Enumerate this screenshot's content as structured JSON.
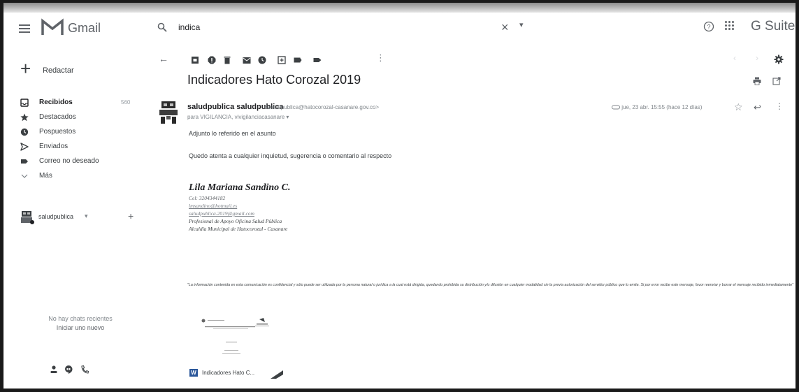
{
  "app": {
    "title": "Gmail",
    "suite_label": "G Suite"
  },
  "search": {
    "value": "indica"
  },
  "sidebar": {
    "compose_label": "Redactar",
    "items": [
      {
        "label": "Recibidos",
        "count": "560",
        "icon": "inbox-icon"
      },
      {
        "label": "Destacados",
        "icon": "star-icon"
      },
      {
        "label": "Pospuestos",
        "icon": "clock-icon"
      },
      {
        "label": "Enviados",
        "icon": "send-icon"
      },
      {
        "label": "Correo no deseado",
        "icon": "spam-icon"
      },
      {
        "label": "Más",
        "icon": "chevron-down-icon"
      }
    ],
    "hangouts_user": "saludpublica",
    "no_chats": "No hay chats recientes",
    "start_chat": "Iniciar uno nuevo"
  },
  "message": {
    "subject": "Indicadores Hato Corozal 2019",
    "sender_name": "saludpublica saludpublica",
    "sender_email": "<saludpublica@hatocorozal-casanare.gov.co>",
    "recipients": "para VIGILANCIA, vivigilanciacasanare",
    "date": "jue, 23 abr. 15:55 (hace 12 días)",
    "body_lines": [
      "Adjunto lo referido en el asunto",
      "Quedo atenta a cualquier inquietud, sugerencia o comentario al respecto"
    ],
    "signature": {
      "name": "Lila  Mariana Sandino C.",
      "phone": "Cel:  3204344182",
      "email1": "lmsandino@hotmail.es",
      "email2": "saludpublica.2019@gmail.com",
      "role": "Profesional de Apoyo Oficina Salud Pública",
      "org": "Alcaldía Municipal de Hatocorozal - Casanare"
    },
    "disclaimer": "\"La información contenida en esta comunicación es confidencial y sólo puede ser utilizada por la persona natural o jurídica a la cual está dirigida, quedando prohibida su distribución y/o difusión en cualquier modalidad sin la previa autorización del servidor público que lo emite. Si por error recibe este mensaje, favor reenviar y borrar el mensaje recibido inmediatamente\"",
    "attachment_name": "Indicadores Hato C..."
  }
}
